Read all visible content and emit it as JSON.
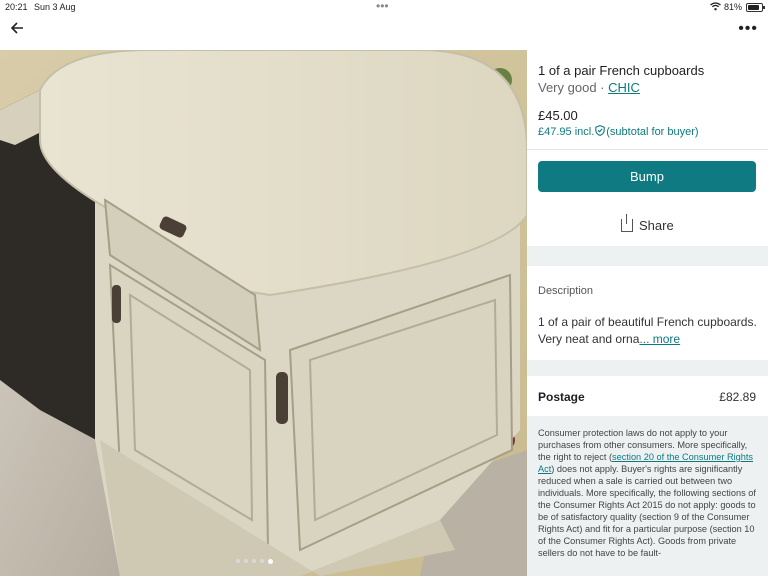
{
  "status_bar": {
    "time": "20:21",
    "date": "Sun 3 Aug",
    "battery": "81%",
    "battery_level": 0.81
  },
  "header": {
    "back_icon": "arrow-left-icon",
    "menu_icon": "more-horizontal-icon"
  },
  "gallery": {
    "photo_count": 5,
    "active_index": 4
  },
  "listing": {
    "title": "1 of a pair French cupboards",
    "condition": "Very good",
    "separator": "·",
    "brand": "CHIC",
    "price": "£45.00",
    "price_incl": "£47.95 incl.",
    "price_note": "(subtotal for buyer)"
  },
  "actions": {
    "bump_label": "Bump",
    "share_label": "Share"
  },
  "description": {
    "heading": "Description",
    "text": "1 of a pair of beautiful French cupboards. Very neat and orna",
    "more_label": "... more"
  },
  "postage": {
    "label": "Postage",
    "value": "£82.89"
  },
  "legal": {
    "part1": "Consumer protection laws do not apply to your purchases from other consumers. More specifically, the right to reject (",
    "link": "section 20 of the Consumer Rights Act",
    "part2": ") does not apply. Buyer's rights are significantly reduced when a sale is carried out between two individuals. More specifically, the following sections of the Consumer Rights Act 2015 do not apply: goods to be of satisfactory quality (section 9 of the Consumer Rights Act) and fit for a particular purpose (section 10 of the Consumer Rights Act). Goods from private sellers do not have to be fault-"
  }
}
